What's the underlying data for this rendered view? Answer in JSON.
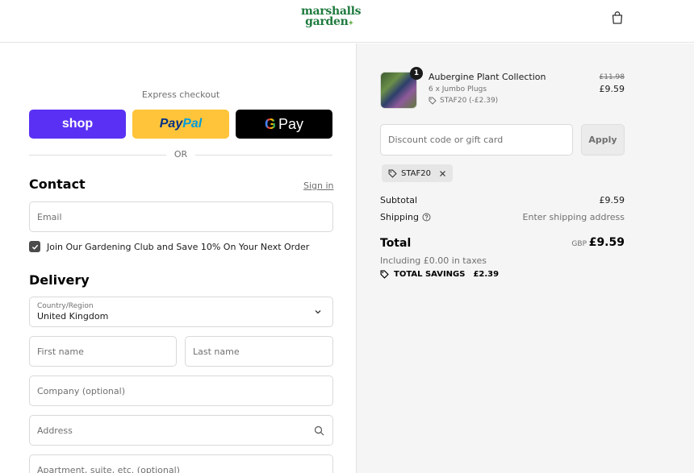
{
  "header": {
    "logo_line1": "marshalls",
    "logo_line2": "garden",
    "cart_icon": "shopping-bag-icon"
  },
  "express": {
    "label": "Express checkout",
    "shop_label": "shop",
    "paypal_part1": "Pay",
    "paypal_part2": "Pal",
    "gpay_g": "G",
    "gpay_label": "Pay",
    "or_label": "OR"
  },
  "contact": {
    "title": "Contact",
    "sign_in": "Sign in",
    "email_placeholder": "Email",
    "newsletter_label": "Join Our Gardening Club and Save 10% On Your Next Order",
    "newsletter_checked": true
  },
  "delivery": {
    "title": "Delivery",
    "country_label": "Country/Region",
    "country_value": "United Kingdom",
    "first_name_placeholder": "First name",
    "last_name_placeholder": "Last name",
    "company_placeholder": "Company (optional)",
    "address_placeholder": "Address",
    "apartment_placeholder": "Apartment, suite, etc. (optional)"
  },
  "summary": {
    "product": {
      "quantity": "1",
      "name": "Aubergine Plant Collection",
      "variant": "6 x Jumbo Plugs",
      "discount": "STAF20 (-£2.39)",
      "old_price": "£11.98",
      "price": "£9.59"
    },
    "discount_placeholder": "Discount code or gift card",
    "apply_label": "Apply",
    "applied_code": "STAF20",
    "subtotal_label": "Subtotal",
    "subtotal_value": "£9.59",
    "shipping_label": "Shipping",
    "shipping_value": "Enter shipping address",
    "total_label": "Total",
    "total_currency": "GBP",
    "total_value": "£9.59",
    "taxes_note": "Including £0.00 in taxes",
    "savings_label": "TOTAL SAVINGS",
    "savings_value": "£2.39"
  },
  "colors": {
    "brand_green": "#1f7a3e",
    "shop_purple": "#5a31f4",
    "paypal_yellow": "#ffc439"
  }
}
